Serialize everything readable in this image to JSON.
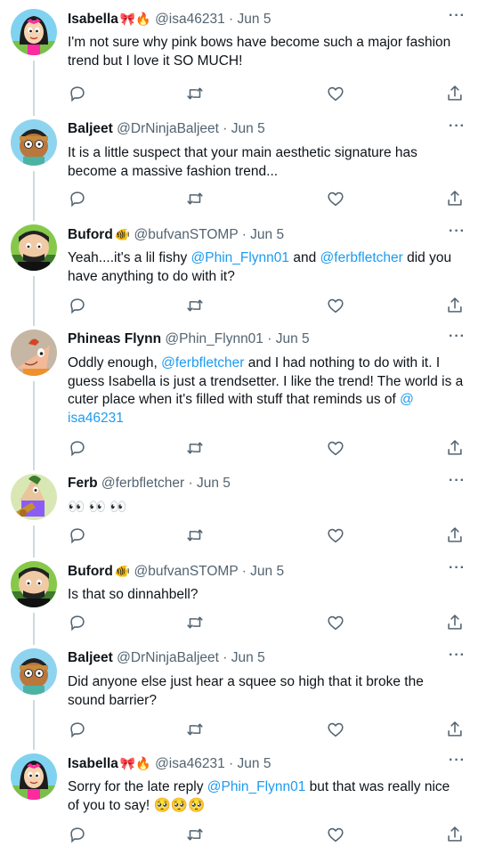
{
  "tweets": [
    {
      "name": "Isabella",
      "emoji": "🎀🔥",
      "handle": "@isa46231",
      "date": "Jun 5",
      "segments": [
        {
          "t": "I'm not sure why pink bows have become such a major fashion trend but I love it SO MUCH!",
          "m": false
        }
      ],
      "avatar": "isabella"
    },
    {
      "name": "Baljeet",
      "emoji": "",
      "handle": "@DrNinjaBaljeet",
      "date": "Jun 5",
      "segments": [
        {
          "t": "It is a little suspect that your main aesthetic signature has become a massive fashion trend...",
          "m": false
        }
      ],
      "avatar": "baljeet"
    },
    {
      "name": "Buford",
      "emoji": "🐠",
      "handle": "@bufvanSTOMP",
      "date": "Jun 5",
      "segments": [
        {
          "t": "Yeah....it's a lil fishy ",
          "m": false
        },
        {
          "t": "@Phin_Flynn01",
          "m": true
        },
        {
          "t": " and ",
          "m": false
        },
        {
          "t": "@ferbfletcher",
          "m": true
        },
        {
          "t": " did you have anything to do with it?",
          "m": false
        }
      ],
      "avatar": "buford"
    },
    {
      "name": "Phineas Flynn",
      "emoji": "",
      "handle": "@Phin_Flynn01",
      "date": "Jun 5",
      "segments": [
        {
          "t": "Oddly enough, ",
          "m": false
        },
        {
          "t": "@ferbfletcher",
          "m": true
        },
        {
          "t": " and I had nothing to do with it. I guess Isabella is just a trendsetter. I like the trend! The world is a cuter place when it's filled with stuff that reminds us of ",
          "m": false
        },
        {
          "t": "@ isa46231",
          "m": true
        }
      ],
      "avatar": "phineas"
    },
    {
      "name": "Ferb",
      "emoji": "",
      "handle": "@ferbfletcher",
      "date": "Jun 5",
      "segments": [
        {
          "t": "👀 👀 👀",
          "m": false
        }
      ],
      "avatar": "ferb"
    },
    {
      "name": "Buford",
      "emoji": "🐠",
      "handle": "@bufvanSTOMP",
      "date": "Jun 5",
      "segments": [
        {
          "t": "Is that so dinnahbell?",
          "m": false
        }
      ],
      "avatar": "buford"
    },
    {
      "name": "Baljeet",
      "emoji": "",
      "handle": "@DrNinjaBaljeet",
      "date": "Jun 5",
      "segments": [
        {
          "t": "Did anyone else just hear a squee so high that it broke the sound barrier?",
          "m": false
        }
      ],
      "avatar": "baljeet"
    },
    {
      "name": "Isabella",
      "emoji": "🎀🔥",
      "handle": "@isa46231",
      "date": "Jun 5",
      "segments": [
        {
          "t": "Sorry for the late reply ",
          "m": false
        },
        {
          "t": "@Phin_Flynn01",
          "m": true
        },
        {
          "t": " but that was really nice of you to say! ",
          "m": false
        },
        {
          "t": "🥺🥺🥺",
          "m": false
        }
      ],
      "avatar": "isabella"
    }
  ],
  "separator": "·",
  "more_label": "···",
  "icons": {
    "reply": "reply-icon",
    "retweet": "retweet-icon",
    "like": "like-icon",
    "share": "share-icon"
  },
  "colors": {
    "mention": "#1d9bf0",
    "muted": "#536471",
    "thread_line": "#cfd9de"
  }
}
